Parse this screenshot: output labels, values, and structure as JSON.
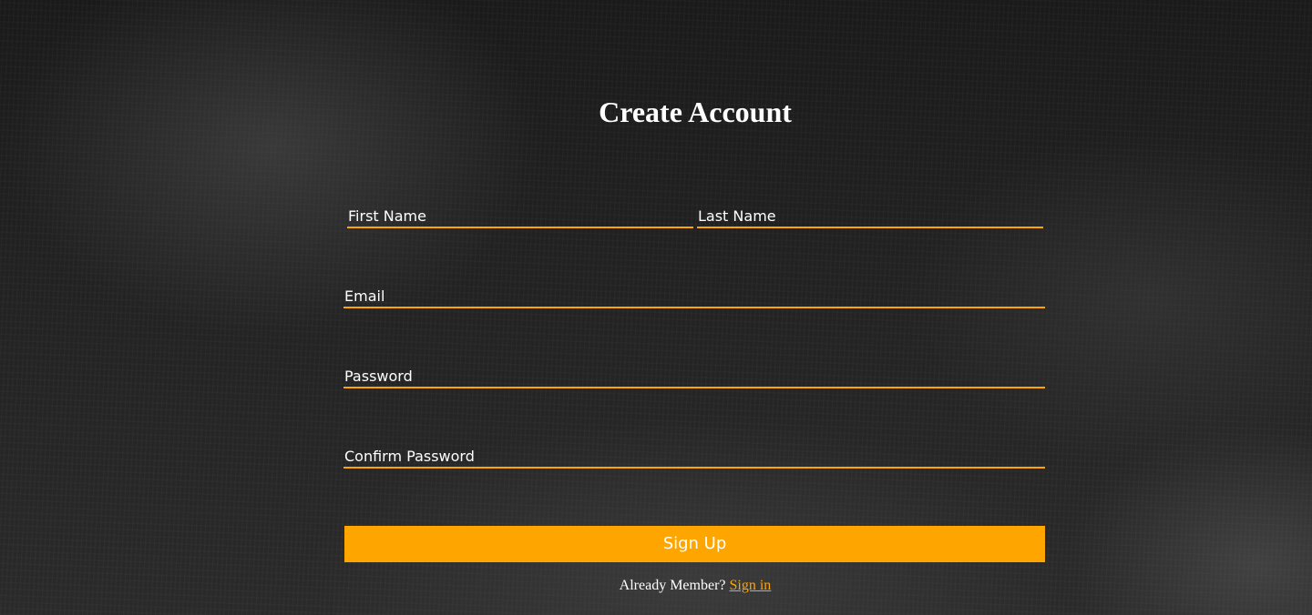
{
  "form": {
    "title": "Create Account",
    "first_name_placeholder": "First Name",
    "last_name_placeholder": "Last Name",
    "email_placeholder": "Email",
    "password_placeholder": "Password",
    "confirm_password_placeholder": "Confirm Password",
    "submit_label": "Sign Up",
    "member_text": "Already Member?",
    "signin_link": "Sign in"
  },
  "colors": {
    "accent": "#ffa500",
    "text": "#ffffff",
    "background": "#1e1e1e"
  }
}
